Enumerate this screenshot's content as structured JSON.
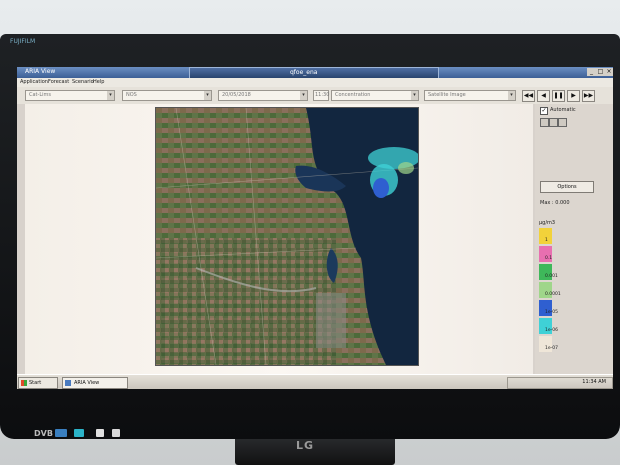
{
  "monitor": {
    "brand": "FUJIFILM",
    "maker": "LG",
    "dvb": "DVB"
  },
  "app": {
    "title": "ARIA View"
  },
  "remote": {
    "title": "qfoe_ena"
  },
  "window_controls": [
    "_",
    "□",
    "×"
  ],
  "menu": [
    "Application",
    "Forecast",
    "Scenario",
    "Help"
  ],
  "toolbar": {
    "combos": [
      "Cat-Lims",
      "NOS",
      "20/05/2018",
      "Concentration",
      "Satellite Image"
    ],
    "time_value": "11:30",
    "nav": [
      "◀◀",
      "◀",
      "❚❚",
      "▶",
      "▶▶"
    ]
  },
  "side": {
    "automatic_label": "Automatic",
    "automatic_checked": "✓",
    "options_label": "Options",
    "max_label": "Max : 0.000",
    "unit": "µg/m3",
    "legend": [
      {
        "label": "1",
        "color": "#f2d23a"
      },
      {
        "label": "0.1",
        "color": "#e86fb0"
      },
      {
        "label": "0.001",
        "color": "#3eb85a"
      },
      {
        "label": "0.0001",
        "color": "#9fd68a"
      },
      {
        "label": "1e-05",
        "color": "#2f5fd0"
      },
      {
        "label": "1e-06",
        "color": "#3fd1d6"
      },
      {
        "label": "1e-07",
        "color": "#efe6d8"
      }
    ]
  },
  "taskbar": {
    "start": "Start",
    "task": "ARIA View",
    "clock": "11:34 AM"
  },
  "icons": {
    "checkbox": "check-icon",
    "save": "save-icon",
    "print": "print-icon",
    "copy": "copy-icon",
    "start": "windows-icon"
  }
}
